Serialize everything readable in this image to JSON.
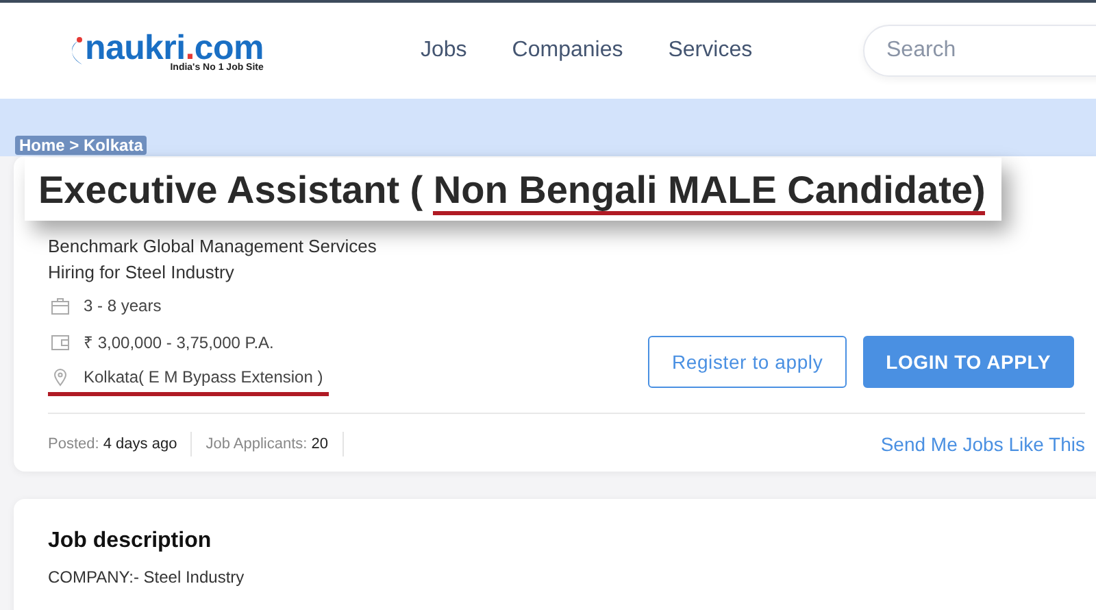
{
  "header": {
    "logo": {
      "name": "naukri",
      "dot": ".",
      "tld": "com",
      "tagline": "India's No 1 Job Site"
    },
    "nav": [
      {
        "label": "Jobs"
      },
      {
        "label": "Companies"
      },
      {
        "label": "Services"
      }
    ],
    "search": {
      "placeholder": "Search"
    }
  },
  "breadcrumb": "Home > Kolkata",
  "job": {
    "title": "Executive Assistant (",
    "title_highlight": "Non Bengali MALE Candidate)",
    "company": "Benchmark Global Management Services",
    "hiring_for": "Hiring for Steel Industry",
    "details": [
      {
        "kind": "experience",
        "text": "3 - 8 years",
        "highlighted": false
      },
      {
        "kind": "salary",
        "text": "₹ 3,00,000 - 3,75,000 P.A.",
        "highlighted": false
      },
      {
        "kind": "location",
        "text": "Kolkata( E M Bypass Extension )",
        "highlighted": true
      }
    ],
    "buttons": [
      {
        "kind": "outline",
        "label": "Register to apply"
      },
      {
        "kind": "primary",
        "label": "LOGIN TO APPLY"
      }
    ],
    "stats": [
      {
        "label": "Posted:",
        "value": "4 days ago"
      },
      {
        "label": "Job Applicants:",
        "value": "20"
      }
    ],
    "link": "Send Me Jobs Like This"
  },
  "description": {
    "heading": "Job description",
    "lines": [
      "COMPANY:- Steel Industry"
    ]
  }
}
